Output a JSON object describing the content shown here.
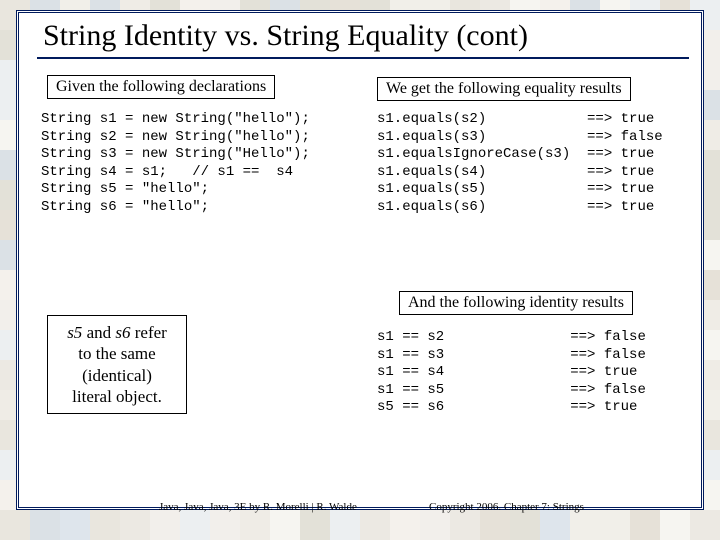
{
  "title": "String Identity vs. String Equality (cont)",
  "labels": {
    "declarations": "Given the following declarations",
    "equality": "We get the following equality results",
    "identity": "And the following identity results"
  },
  "code": {
    "declarations": "String s1 = new String(\"hello\");\nString s2 = new String(\"hello\");\nString s3 = new String(\"Hello\");\nString s4 = s1;   // s1 ==  s4\nString s5 = \"hello\";\nString s6 = \"hello\";",
    "equality": "s1.equals(s2)            ==> true\ns1.equals(s3)            ==> false\ns1.equalsIgnoreCase(s3)  ==> true\ns1.equals(s4)            ==> true\ns1.equals(s5)            ==> true\ns1.equals(s6)            ==> true",
    "identity": "s1 == s2               ==> false\ns1 == s3               ==> false\ns1 == s4               ==> true\ns1 == s5               ==> false\ns5 == s6               ==> true"
  },
  "note": {
    "pre": "",
    "s5": "s5",
    "and": " and ",
    "s6": "s6",
    "rest": " refer\nto the same\n(identical)\nliteral object."
  },
  "footer": {
    "left": "Java, Java, Java, 3E by R. Morelli | R. Walde",
    "right": "Copyright 2006.  Chapter 7: Strings"
  }
}
